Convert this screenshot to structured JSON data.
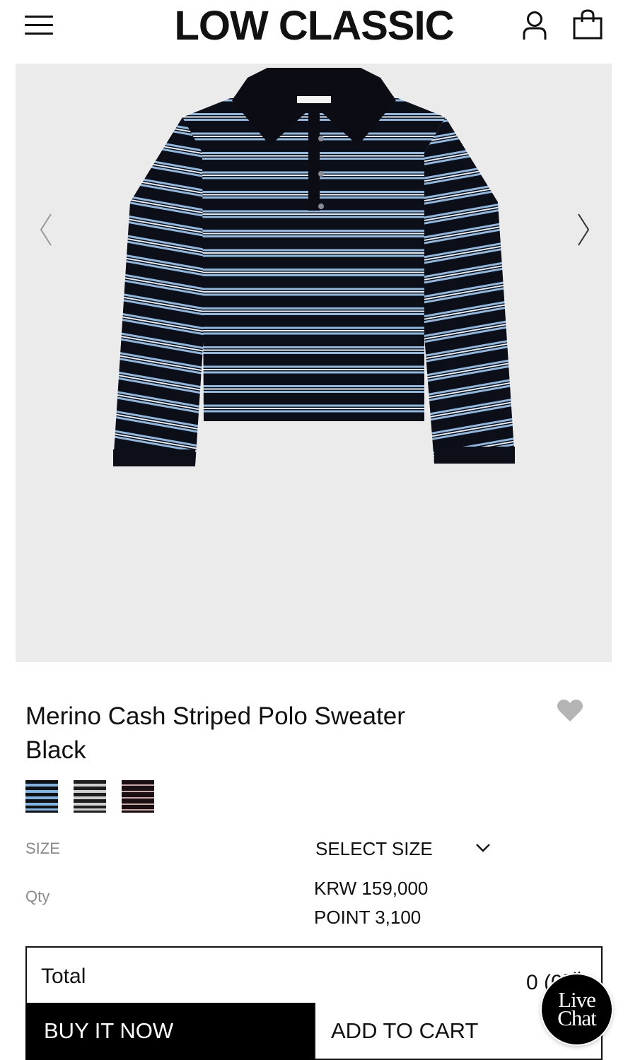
{
  "header": {
    "logo": "LOW CLASSIC",
    "menu_icon": "hamburger-menu-icon",
    "user_icon": "user-icon",
    "cart_icon": "shopping-bag-icon"
  },
  "gallery": {
    "prev_icon": "chevron-left-icon",
    "next_icon": "chevron-right-icon",
    "background": "#ebebeb"
  },
  "product": {
    "title_line1": "Merino Cash Striped Polo Sweater",
    "title_line2": "Black",
    "wishlist_icon": "heart-icon"
  },
  "swatches": [
    {
      "colors": [
        "#1a1a1a",
        "#7fb4e6"
      ]
    },
    {
      "colors": [
        "#1a1a1a",
        "#d9d9d9"
      ]
    },
    {
      "colors": [
        "#1a1216",
        "#c9a7a7"
      ]
    }
  ],
  "options": {
    "size_label": "SIZE",
    "size_select": "SELECT SIZE",
    "qty_label": "Qty",
    "price": "KRW 159,000",
    "point": "POINT 3,100"
  },
  "total": {
    "label": "Total",
    "value": "0 (0개)"
  },
  "actions": {
    "buy_now": "BUY IT NOW",
    "add_to_cart": "ADD TO CART"
  },
  "livechat": {
    "line1": "Live",
    "line2": "Chat"
  }
}
